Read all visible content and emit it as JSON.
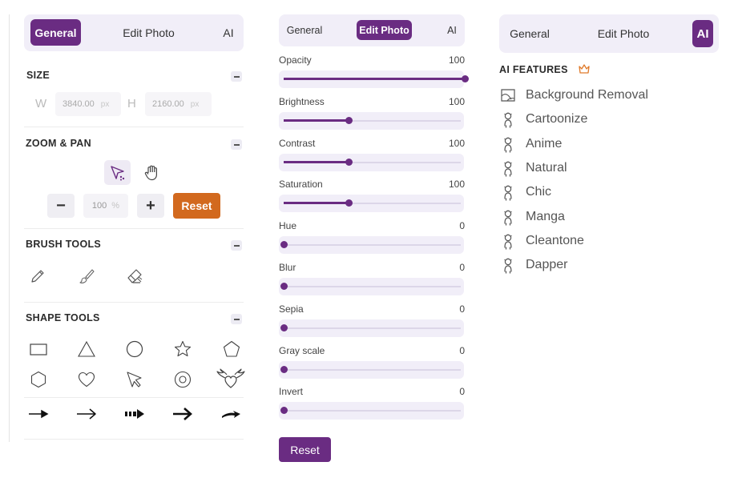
{
  "panel_general": {
    "tabs": [
      {
        "label": "General",
        "active": true
      },
      {
        "label": "Edit Photo",
        "active": false
      },
      {
        "label": "AI",
        "active": false
      }
    ],
    "size": {
      "title": "SIZE",
      "width_label": "W",
      "width_value": "3840.00",
      "height_label": "H",
      "height_value": "2160.00",
      "unit": "px"
    },
    "zoom": {
      "title": "ZOOM & PAN",
      "minus": "−",
      "value": "100",
      "unit": "%",
      "plus": "+",
      "reset": "Reset"
    },
    "brush": {
      "title": "BRUSH TOOLS",
      "tools": [
        "pencil-icon",
        "brush-icon",
        "eraser-icon"
      ]
    },
    "shape": {
      "title": "SHAPE TOOLS",
      "shapes": [
        "rectangle-icon",
        "triangle-icon",
        "circle-icon",
        "star-icon",
        "pentagon-icon",
        "hexagon-icon",
        "heart-icon",
        "pointer-shape-icon",
        "ring-icon",
        "winged-heart-icon"
      ],
      "arrows": [
        "arrow-thin-icon",
        "arrow-open-icon",
        "arrow-dashed-icon",
        "arrow-bold-icon",
        "arrow-curved-icon"
      ]
    }
  },
  "panel_edit": {
    "tabs": [
      {
        "label": "General",
        "active": false
      },
      {
        "label": "Edit Photo",
        "active": true
      },
      {
        "label": "AI",
        "active": false
      }
    ],
    "sliders": [
      {
        "label": "Opacity",
        "value": 100,
        "fill": 1.0
      },
      {
        "label": "Brightness",
        "value": 100,
        "fill": 0.36
      },
      {
        "label": "Contrast",
        "value": 100,
        "fill": 0.36
      },
      {
        "label": "Saturation",
        "value": 100,
        "fill": 0.36
      },
      {
        "label": "Hue",
        "value": 0,
        "fill": 0
      },
      {
        "label": "Blur",
        "value": 0,
        "fill": 0
      },
      {
        "label": "Sepia",
        "value": 0,
        "fill": 0
      },
      {
        "label": "Gray scale",
        "value": 0,
        "fill": 0
      },
      {
        "label": "Invert",
        "value": 0,
        "fill": 0
      }
    ],
    "reset": "Reset"
  },
  "panel_ai": {
    "tabs": [
      {
        "label": "General",
        "active": false
      },
      {
        "label": "Edit Photo",
        "active": false
      },
      {
        "label": "AI",
        "active": true
      }
    ],
    "title": "AI FEATURES",
    "title_icon": "crown-icon",
    "features": [
      {
        "label": "Background Removal",
        "icon": "background-removal-icon"
      },
      {
        "label": "Cartoonize",
        "icon": "figure-icon"
      },
      {
        "label": "Anime",
        "icon": "figure-icon"
      },
      {
        "label": "Natural",
        "icon": "figure-icon"
      },
      {
        "label": "Chic",
        "icon": "figure-icon"
      },
      {
        "label": "Manga",
        "icon": "figure-icon"
      },
      {
        "label": "Cleantone",
        "icon": "figure-icon"
      },
      {
        "label": "Dapper",
        "icon": "figure-icon"
      }
    ]
  },
  "colors": {
    "accent": "#6a2c82",
    "reset_orange": "#d2691e",
    "tab_bg": "#f1eef8"
  }
}
